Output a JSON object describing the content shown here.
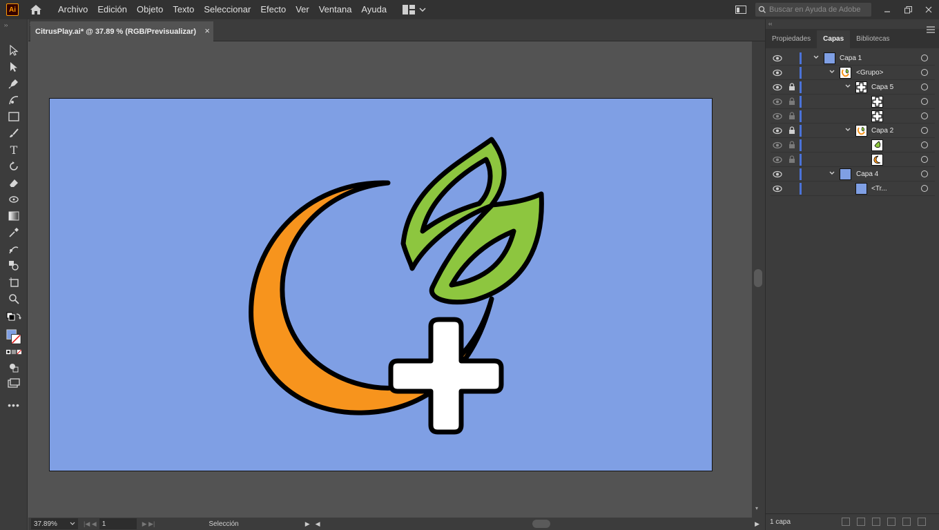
{
  "app": {
    "logo_text": "Ai"
  },
  "menu": [
    "Archivo",
    "Edición",
    "Objeto",
    "Texto",
    "Seleccionar",
    "Efecto",
    "Ver",
    "Ventana",
    "Ayuda"
  ],
  "search": {
    "placeholder": "Buscar en Ayuda de Adobe"
  },
  "document": {
    "tab_title": "CitrusPlay.ai* @ 37.89 % (RGB/Previsualizar)",
    "close_glyph": "×"
  },
  "status": {
    "zoom": "37.89%",
    "artboard": "1",
    "tool": "Selección"
  },
  "panel": {
    "tabs": [
      "Propiedades",
      "Capas",
      "Bibliotecas"
    ],
    "active_tab": "Capas",
    "layer_count": "1 capa",
    "rows": [
      {
        "name": "Capa 1",
        "locked": false
      },
      {
        "name": "<Grupo>",
        "locked": false
      },
      {
        "name": "Capa 5",
        "locked": true
      },
      {
        "name": "",
        "locked": true
      },
      {
        "name": "",
        "locked": true
      },
      {
        "name": "Capa 2",
        "locked": true
      },
      {
        "name": "",
        "locked": true
      },
      {
        "name": "",
        "locked": true
      },
      {
        "name": "Capa 4",
        "locked": false
      },
      {
        "name": "<Tr...",
        "locked": false
      }
    ]
  },
  "colors": {
    "artboard": "#7f9fe4",
    "orange": "#f7941d",
    "green": "#8dc63f",
    "layer_accent": "#4b73d9"
  }
}
